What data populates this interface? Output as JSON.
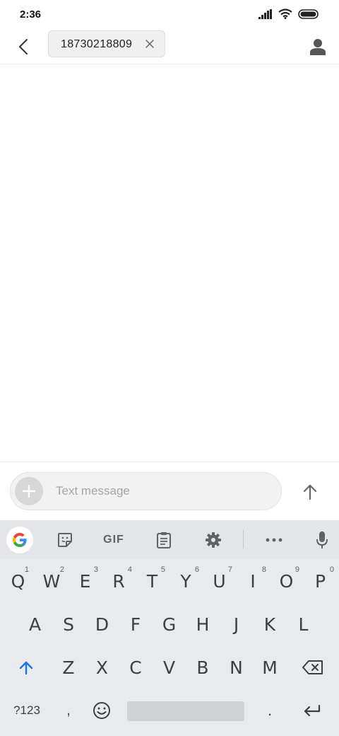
{
  "status_bar": {
    "time": "2:36",
    "icons": [
      "signal-icon",
      "wifi-icon",
      "battery-icon"
    ]
  },
  "app_bar": {
    "back_icon": "back-arrow-icon",
    "recipient": "18730218809",
    "chip_close_icon": "close-icon",
    "contact_icon": "person-icon"
  },
  "compose": {
    "attach_icon": "plus-icon",
    "placeholder": "Text message",
    "value": "",
    "send_icon": "arrow-up-icon"
  },
  "keyboard": {
    "toolbar": {
      "google_icon": "google-g-icon",
      "sticker_icon": "sticker-icon",
      "gif_label": "GIF",
      "clipboard_icon": "clipboard-icon",
      "settings_icon": "gear-icon",
      "more_icon": "more-horizontal-icon",
      "mic_icon": "mic-icon"
    },
    "row1": [
      {
        "key": "Q",
        "hint": "1"
      },
      {
        "key": "W",
        "hint": "2"
      },
      {
        "key": "E",
        "hint": "3"
      },
      {
        "key": "R",
        "hint": "4"
      },
      {
        "key": "T",
        "hint": "5"
      },
      {
        "key": "Y",
        "hint": "6"
      },
      {
        "key": "U",
        "hint": "7"
      },
      {
        "key": "I",
        "hint": "8"
      },
      {
        "key": "O",
        "hint": "9"
      },
      {
        "key": "P",
        "hint": "0"
      }
    ],
    "row2": [
      "A",
      "S",
      "D",
      "F",
      "G",
      "H",
      "J",
      "K",
      "L"
    ],
    "row3": [
      "Z",
      "X",
      "C",
      "V",
      "B",
      "N",
      "M"
    ],
    "row4": {
      "symbols_label": "?123",
      "comma_label": ",",
      "emoji_icon": "emoji-icon",
      "period_label": ".",
      "enter_icon": "enter-icon"
    },
    "shift_icon": "shift-icon",
    "backspace_icon": "backspace-icon",
    "colors": {
      "accent": "#1a73e8",
      "key_text": "#3c4043",
      "background": "#e8eaed"
    }
  }
}
